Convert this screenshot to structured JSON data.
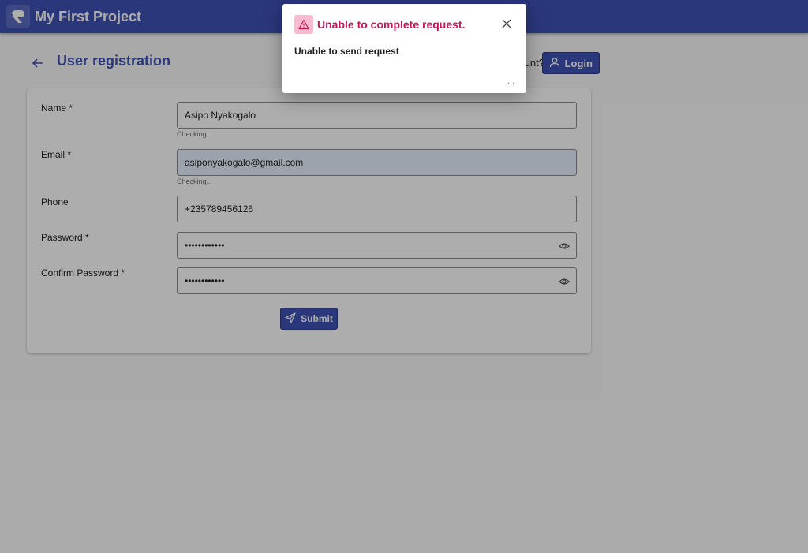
{
  "app": {
    "title": "My First Project"
  },
  "header": {
    "title": "User registration",
    "account_prompt": "unt?",
    "login_label": "Login"
  },
  "form": {
    "name": {
      "label": "Name *",
      "value": "Asipo Nyakogalo",
      "hint": "Checking..."
    },
    "email": {
      "label": "Email *",
      "value": "asiponyakogalo@gmail.com",
      "hint": "Checking..."
    },
    "phone": {
      "label": "Phone",
      "value": "+235789456126"
    },
    "password": {
      "label": "Password *",
      "value": "••••••••••••"
    },
    "confirm_password": {
      "label": "Confirm Password *",
      "value": "••••••••••••"
    },
    "submit_label": "Submit"
  },
  "dialog": {
    "title": "Unable to complete request.",
    "message": "Unable to send request",
    "more": "..."
  },
  "colors": {
    "primary": "#3f51b5",
    "error": "#c2185b",
    "error_bg": "#f8bbd0",
    "autofill": "#e8f0fe"
  },
  "icons": [
    "logo-icon",
    "back-arrow-icon",
    "user-icon",
    "eye-icon",
    "send-icon",
    "warning-icon",
    "close-icon"
  ]
}
